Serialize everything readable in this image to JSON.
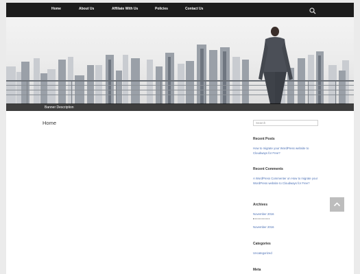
{
  "nav": {
    "items": [
      {
        "label": "Home"
      },
      {
        "label": "About Us"
      },
      {
        "label": "Affiliate With Us"
      },
      {
        "label": "Policies"
      },
      {
        "label": "Contact Us"
      }
    ]
  },
  "banner": {
    "caption": "Banner Description"
  },
  "main": {
    "title": "Home"
  },
  "sidebar": {
    "search": {
      "placeholder": "Search"
    },
    "recent_posts": {
      "title": "Recent Posts",
      "items": [
        "How to migrate your WordPress website to Cloudways for Free?"
      ]
    },
    "recent_comments": {
      "title": "Recent Comments",
      "items": [
        "A WordPress Commenter on How to migrate your WordPress website to Cloudways for Free?"
      ]
    },
    "archives": {
      "title": "Archives",
      "items": [
        "November 2016",
        "November 2016"
      ]
    },
    "categories": {
      "title": "Categories",
      "items": [
        "Uncategorized"
      ]
    },
    "meta": {
      "title": "Meta"
    }
  },
  "icons": {
    "search": "search-icon",
    "scroll_top": "chevron-up-icon"
  },
  "colors": {
    "nav_bg": "#1d1d1d",
    "link": "#4a6fb5",
    "caption_bg": "#000000"
  }
}
